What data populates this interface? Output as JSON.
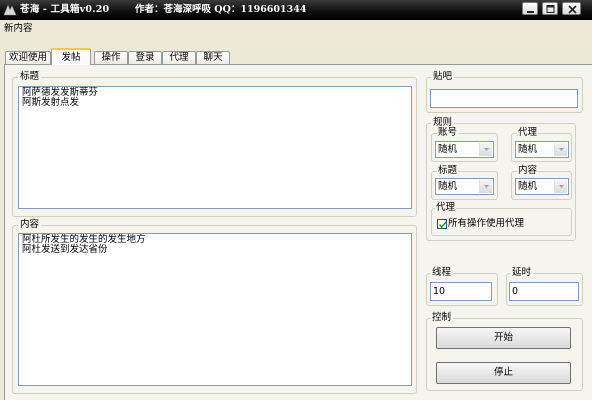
{
  "window": {
    "title": "苍海 - 工具箱v0.20",
    "author": "作者：苍海深呼吸   QQ：1196601344",
    "icon": "app-icon"
  },
  "menu": {
    "new_content": "新内容"
  },
  "tabs": [
    {
      "label": "欢迎使用",
      "active": false
    },
    {
      "label": "发帖",
      "active": true
    },
    {
      "label": "操作",
      "active": false
    },
    {
      "label": "登录",
      "active": false
    },
    {
      "label": "代理",
      "active": false
    },
    {
      "label": "聊天",
      "active": false
    }
  ],
  "post": {
    "title_label": "标题",
    "title_value": "阿萨德发发斯蒂芬\n阿斯发射点发",
    "content_label": "内容",
    "content_value": "阿杜所发生的发生的发生地方\n阿杜发送到发达省份"
  },
  "forum": {
    "label": "贴吧",
    "value": ""
  },
  "rules": {
    "label": "规则",
    "account_label": "账号",
    "account_value": "随机",
    "proxy_label": "代理",
    "proxy_value": "随机",
    "title_label": "标题",
    "title_value": "随机",
    "content_label": "内容",
    "content_value": "随机",
    "proxy_group_label": "代理",
    "proxy_checkbox_label": "所有操作使用代理",
    "proxy_checked": true
  },
  "threads": {
    "label": "线程",
    "value": "10"
  },
  "delay": {
    "label": "延时",
    "value": "0"
  },
  "control": {
    "label": "控制",
    "start_label": "开始",
    "stop_label": "停止"
  }
}
